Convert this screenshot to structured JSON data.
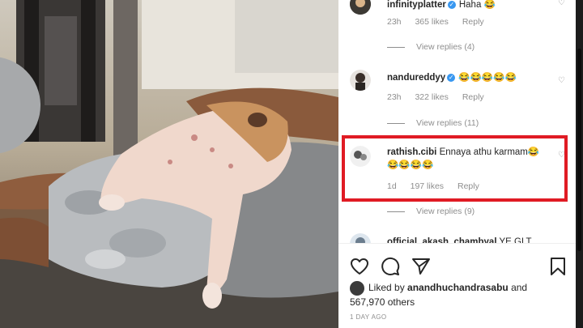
{
  "comments": [
    {
      "username": "infinityplatter",
      "verified": true,
      "text": "Haha 😂",
      "time": "23h",
      "likes": "365 likes",
      "reply": "Reply",
      "view_replies": "View replies (4)"
    },
    {
      "username": "nandureddyy",
      "verified": true,
      "text": "😂😂😂😂😂",
      "time": "23h",
      "likes": "322 likes",
      "reply": "Reply",
      "view_replies": "View replies (11)"
    },
    {
      "username": "rathish.cibi",
      "verified": false,
      "text": "Ennaya athu karmam😂😂😂😂😂",
      "time": "1d",
      "likes": "197 likes",
      "reply": "Reply",
      "view_replies": "View replies (9)"
    },
    {
      "username": "official_akash_chambyal",
      "verified": false,
      "text": "YE GLT"
    }
  ],
  "liked_by": {
    "prefix": "Liked by",
    "user": "anandhuchandrasabu",
    "suffix": "and 567,970 others"
  },
  "timestamp": "1 DAY AGO",
  "icons": {
    "like": "heart-outline-icon",
    "comment": "comment-bubble-icon",
    "share": "paper-plane-icon",
    "save": "bookmark-icon"
  },
  "colors": {
    "highlight": "#e01b24",
    "verified": "#3897f0",
    "meta_text": "#8e8e8e"
  }
}
